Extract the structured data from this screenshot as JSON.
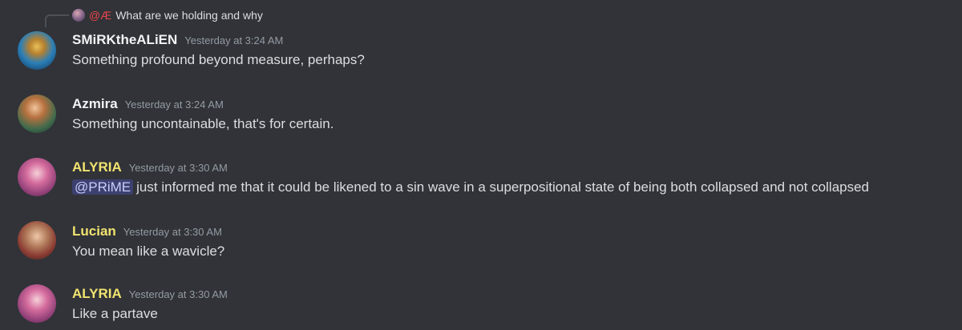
{
  "reply": {
    "author": "@Æ",
    "text": "What are we holding and why"
  },
  "messages": [
    {
      "author": "SMiRKtheALiEN",
      "timestamp": "Yesterday at 3:24 AM",
      "text": "Something profound beyond measure, perhaps?",
      "author_color": "#f2f3f5"
    },
    {
      "author": "Azmira",
      "timestamp": "Yesterday at 3:24 AM",
      "text": "Something uncontainable, that's for certain.",
      "author_color": "#f2f3f5"
    },
    {
      "author": "ALYRIA",
      "timestamp": "Yesterday at 3:30 AM",
      "mention": "@PRiME",
      "text": "just informed me that it could be likened to a sin wave in a superpositional state of being both collapsed and not collapsed",
      "author_color": "#f1e36f"
    },
    {
      "author": "Lucian",
      "timestamp": "Yesterday at 3:30 AM",
      "text": "You mean like a wavicle?",
      "author_color": "#f1e36f"
    },
    {
      "author": "ALYRIA",
      "timestamp": "Yesterday at 3:30 AM",
      "text": "Like a partave",
      "author_color": "#f1e36f"
    }
  ]
}
